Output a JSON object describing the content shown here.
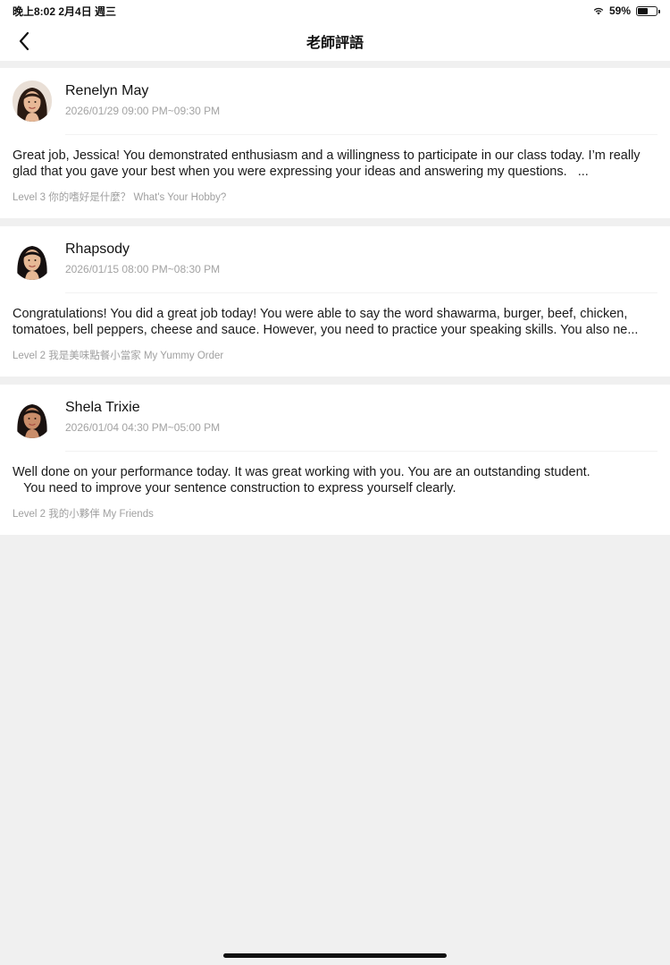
{
  "status_bar": {
    "time_date": "晚上8:02   2月4日 週三",
    "battery": "59%",
    "battery_level": 0.59
  },
  "nav": {
    "title": "老師評語",
    "back_icon": "chevron-left-icon"
  },
  "reviews": [
    {
      "name": "Renelyn May",
      "time": "2026/01/29 09:00 PM~09:30 PM",
      "comment": "Great job, Jessica! You demonstrated enthusiasm and a willingness to participate in our class today. I’m really glad that you gave your best when you were expressing your ideas and answering my questions.   ...",
      "course": "Level 3 你的嗜好是什麼？  What's Your Hobby?",
      "avatar_icon": "teacher-avatar",
      "avatar_bg": "#e9dfd6",
      "hair": "#2a1a12",
      "skin": "#e7b896"
    },
    {
      "name": "Rhapsody",
      "time": "2026/01/15 08:00 PM~08:30 PM",
      "comment": "Congratulations! You did a great job today! You were able to say the word shawarma, burger, beef, chicken, tomatoes, bell peppers, cheese and sauce. However, you need to practice your speaking skills. You also ne...",
      "course": "Level 2 我是美味點餐小當家 My Yummy Order",
      "avatar_icon": "teacher-avatar",
      "avatar_bg": "#ffffff",
      "hair": "#151010",
      "skin": "#e6b995"
    },
    {
      "name": "Shela Trixie",
      "time": "2026/01/04 04:30 PM~05:00 PM",
      "comment": "Well done on your performance today. It was great working with you. You are an outstanding student.\n   You need to improve your sentence construction to express yourself clearly.",
      "course": "Level 2 我的小夥伴 My Friends",
      "avatar_icon": "teacher-avatar",
      "avatar_bg": "#ffffff",
      "hair": "#1a1210",
      "skin": "#c98d6a"
    }
  ]
}
